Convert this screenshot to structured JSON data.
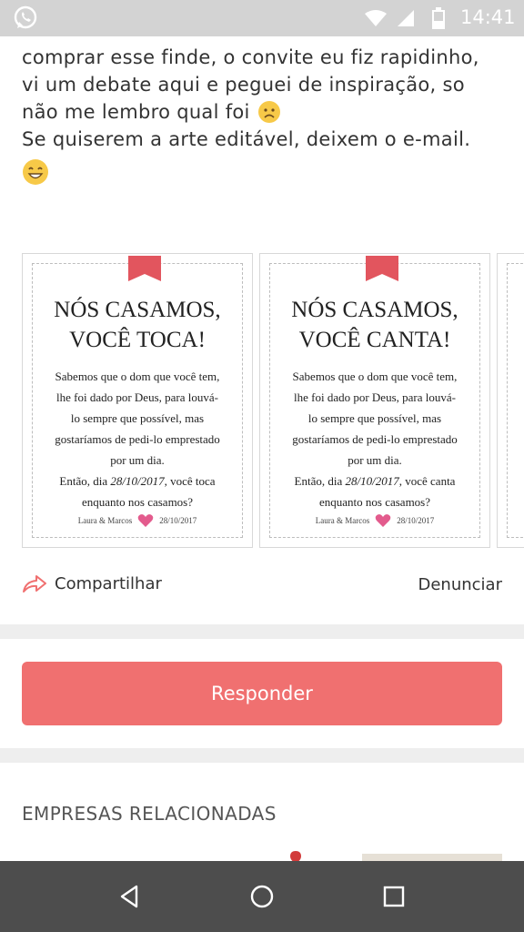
{
  "status_bar": {
    "time": "14:41"
  },
  "post": {
    "lines": [
      "comprar esse finde, o convite eu fiz rapidinho,",
      "vi um debate aqui e peguei de inspiração, so",
      "não me lembro qual foi",
      "Se quiserem a arte editável, deixem o e-mail."
    ],
    "emoji_1": "sad-face",
    "emoji_2": "smiling-face"
  },
  "gallery": {
    "cards": [
      {
        "title_line_1": "NÓS CASAMOS,",
        "title_line_2": "VOCÊ TOCA!",
        "body_lines": [
          "Sabemos que o dom que você tem,",
          "lhe foi dado por Deus, para louvá-",
          "lo sempre que possível, mas",
          "gostaríamos de pedi-lo emprestado",
          "por um dia."
        ],
        "date_line_prefix": "Então, dia ",
        "date": "28/10/2017",
        "date_line_suffix": ", você toca",
        "last_line": "enquanto nos casamos?",
        "couple": "Laura & Marcos",
        "sign_date": "28/10/2017"
      },
      {
        "title_line_1": "NÓS CASAMOS,",
        "title_line_2": "VOCÊ CANTA!",
        "body_lines": [
          "Sabemos que o dom que você tem,",
          "lhe foi dado por Deus, para louvá-",
          "lo sempre que possível, mas",
          "gostaríamos de pedi-lo emprestado",
          "por um dia."
        ],
        "date_line_prefix": "Então, dia ",
        "date": "28/10/2017",
        "date_line_suffix": ", você canta",
        "last_line": "enquanto nos casamos?",
        "couple": "Laura & Marcos",
        "sign_date": "28/10/2017"
      }
    ]
  },
  "actions": {
    "share_label": "Compartilhar",
    "report_label": "Denunciar"
  },
  "respond_button": "Responder",
  "related_heading": "EMPRESAS RELACIONADAS",
  "colors": {
    "accent": "#f07070",
    "ribbon": "#e2555e",
    "heart": "#e35b8d",
    "statusbar": "#d3d3d3",
    "navbar": "#4d4d4d"
  },
  "icons": {
    "statusbar": [
      "whatsapp-icon",
      "wifi-icon",
      "signal-icon",
      "battery-icon"
    ],
    "navbar": [
      "back-icon",
      "home-icon",
      "recents-icon"
    ]
  }
}
